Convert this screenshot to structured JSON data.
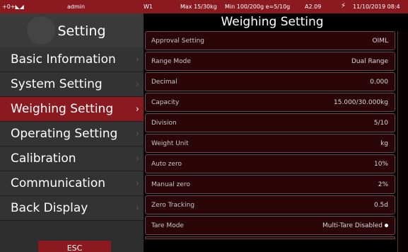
{
  "status": {
    "icons": "+0+◣◢",
    "user": "admin",
    "scale": "W1",
    "max": "Max 15/30kg",
    "min": "Min 100/200g e=5/10g",
    "version": "A2.09",
    "power_icon": "lightning-icon",
    "date": "11/10/2019 08:4"
  },
  "sidebar": {
    "title": "Setting",
    "items": [
      {
        "label": "Basic Information"
      },
      {
        "label": "System Setting"
      },
      {
        "label": "Weighing Setting",
        "active": true
      },
      {
        "label": "Operating Setting"
      },
      {
        "label": "Calibration"
      },
      {
        "label": "Communication"
      },
      {
        "label": "Back Display"
      }
    ],
    "esc_label": "ESC"
  },
  "main": {
    "title": "Weighing Setting",
    "rows": [
      {
        "label": "Approval Setting",
        "value": "OIML"
      },
      {
        "label": "Range Mode",
        "value": "Dual Range"
      },
      {
        "label": "Decimal",
        "value": "0.000"
      },
      {
        "label": "Capacity",
        "value": "15.000/30.000kg"
      },
      {
        "label": "Division",
        "value": "5/10"
      },
      {
        "label": "Weight Unit",
        "value": "kg"
      },
      {
        "label": "Auto zero",
        "value": "10%"
      },
      {
        "label": "Manual zero",
        "value": "2%"
      },
      {
        "label": "Zero Tracking",
        "value": "0.5d"
      },
      {
        "label": "Tare Mode",
        "value": "Multi-Tare Disabled"
      }
    ]
  },
  "colors": {
    "accent": "#8a1a1f",
    "row_bg": "#2b0608",
    "sidebar_bg": "#333333"
  }
}
